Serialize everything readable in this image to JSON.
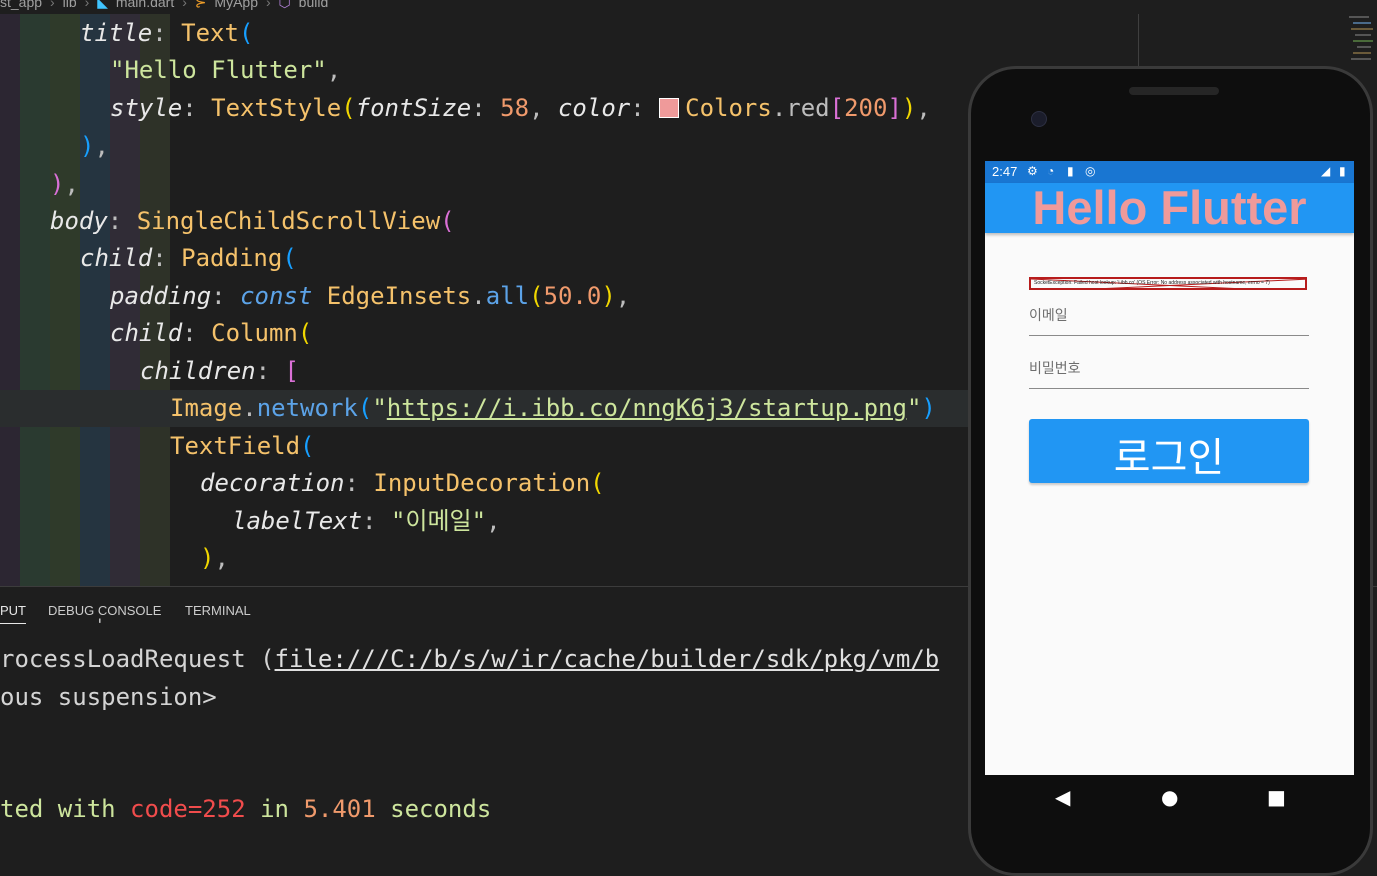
{
  "breadcrumb": [
    "st_app",
    "lib",
    "main.dart",
    "MyApp",
    "build"
  ],
  "colors": {
    "editor_bg": "#1e1e1e",
    "app_bar": "#2196f3",
    "status_bar": "#1976d2",
    "title_color": "#ef9a9a",
    "error_text": "#f14c4c"
  },
  "icons": [
    "folder-chevron-icon",
    "dart-file-icon",
    "class-symbol-icon",
    "method-symbol-icon",
    "color-swatch-icon",
    "settings-icon",
    "wifi-icon",
    "sd-card-icon",
    "sync-icon",
    "signal-icon",
    "battery-icon",
    "back-icon",
    "home-icon",
    "recents-icon"
  ],
  "code": {
    "line1": {
      "prop": "title",
      "colon": ": ",
      "cls": "Text",
      "open": "("
    },
    "line2": {
      "str": "\"Hello Flutter\"",
      "comma": ","
    },
    "line3": {
      "prop1": "style",
      "colon1": ": ",
      "cls": "TextStyle",
      "open": "(",
      "prop2": "fontSize",
      "colon2": ": ",
      "num1": "58",
      "sep": ", ",
      "prop3": "color",
      "colon3": ": ",
      "cls2": "Colors",
      "dot": ".",
      "mem": "red",
      "bopen": "[",
      "num2": "200",
      "bclose": "]",
      "close": ")",
      "comma": ","
    },
    "line4": {
      "close": ")",
      "comma": ","
    },
    "line5": {
      "close": ")",
      "comma": ","
    },
    "line6": {
      "prop": "body",
      "colon": ": ",
      "cls": "SingleChildScrollView",
      "open": "("
    },
    "line7": {
      "prop": "child",
      "colon": ": ",
      "cls": "Padding",
      "open": "("
    },
    "line8": {
      "prop": "padding",
      "colon": ": ",
      "kw": "const",
      "sp": " ",
      "cls": "EdgeInsets",
      "dot": ".",
      "mem": "all",
      "open": "(",
      "num": "50.0",
      "close": ")",
      "comma": ","
    },
    "line9": {
      "prop": "child",
      "colon": ": ",
      "cls": "Column",
      "open": "("
    },
    "line10": {
      "prop": "children",
      "colon": ": ",
      "open": "["
    },
    "line11": {
      "cls": "Image",
      "dot": ".",
      "mem": "network",
      "open": "(",
      "q1": "\"",
      "url": "https://i.ibb.co/nngK6j3/startup.png",
      "q2": "\"",
      "close": ")"
    },
    "line12": {
      "cls": "TextField",
      "open": "("
    },
    "line13": {
      "prop": "decoration",
      "colon": ": ",
      "cls": "InputDecoration",
      "open": "("
    },
    "line14": {
      "prop": "labelText",
      "colon": ": ",
      "str": "\"이메일\"",
      "comma": ","
    },
    "line15": {
      "close": ")",
      "comma": ","
    }
  },
  "panel": {
    "tabs": [
      "PUT",
      "DEBUG CONSOLE",
      "TERMINAL"
    ],
    "output": {
      "tick": "'",
      "line1_pre": "rocessLoadRequest (",
      "line1_link": "file:///C:/b/s/w/ir/cache/builder/sdk/pkg/vm/b",
      "line2": "ous suspension>",
      "line3_a": "ted with ",
      "line3_code": "code=252",
      "line3_b": " in ",
      "line3_num": "5.401",
      "line3_c": " seconds"
    }
  },
  "phone": {
    "status_time": "2:47",
    "app_title": "Hello Flutter",
    "image_error": "SocketException: Failed host lookup: 'i.ibb.co' (OS Error: No address associated with hostname, errno = 7)",
    "email_label": "이메일",
    "password_label": "비밀번호",
    "login_label": "로그인",
    "nav": {
      "back": "◀",
      "home": "●",
      "recents": "■"
    }
  }
}
